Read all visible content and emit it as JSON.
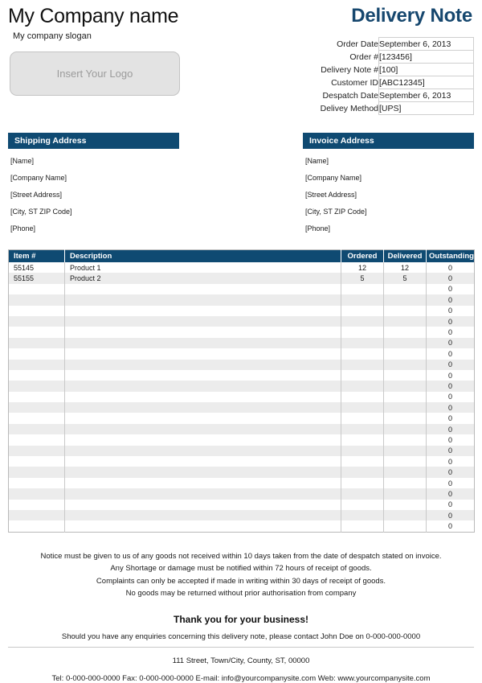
{
  "company": {
    "name": "My Company name",
    "slogan": "My company slogan",
    "logo_placeholder": "Insert Your Logo"
  },
  "document": {
    "title": "Delivery Note",
    "accent_color": "#0f4a72",
    "title_color": "#16476e",
    "fields": [
      {
        "label": "Order Date",
        "value": "September 6, 2013"
      },
      {
        "label": "Order #",
        "value": "[123456]"
      },
      {
        "label": "Delivery Note #",
        "value": "[100]"
      },
      {
        "label": "Customer ID",
        "value": "[ABC12345]"
      },
      {
        "label": "Despatch Date",
        "value": "September 6, 2013"
      },
      {
        "label": "Delivey Method",
        "value": "[UPS]"
      }
    ]
  },
  "shipping_address": {
    "heading": "Shipping Address",
    "lines": [
      "[Name]",
      "[Company Name]",
      "[Street Address]",
      "[City, ST  ZIP Code]",
      "[Phone]"
    ]
  },
  "invoice_address": {
    "heading": "Invoice Address",
    "lines": [
      "[Name]",
      "[Company Name]",
      "[Street Address]",
      "[City, ST  ZIP Code]",
      "[Phone]"
    ]
  },
  "items_table": {
    "columns": [
      "Item #",
      "Description",
      "Ordered",
      "Delivered",
      "Outstanding"
    ],
    "rows": [
      {
        "item": "55145",
        "description": "Product 1",
        "ordered": "12",
        "delivered": "12",
        "outstanding": "0"
      },
      {
        "item": "55155",
        "description": "Product 2",
        "ordered": "5",
        "delivered": "5",
        "outstanding": "0"
      },
      {
        "item": "",
        "description": "",
        "ordered": "",
        "delivered": "",
        "outstanding": "0"
      },
      {
        "item": "",
        "description": "",
        "ordered": "",
        "delivered": "",
        "outstanding": "0"
      },
      {
        "item": "",
        "description": "",
        "ordered": "",
        "delivered": "",
        "outstanding": "0"
      },
      {
        "item": "",
        "description": "",
        "ordered": "",
        "delivered": "",
        "outstanding": "0"
      },
      {
        "item": "",
        "description": "",
        "ordered": "",
        "delivered": "",
        "outstanding": "0"
      },
      {
        "item": "",
        "description": "",
        "ordered": "",
        "delivered": "",
        "outstanding": "0"
      },
      {
        "item": "",
        "description": "",
        "ordered": "",
        "delivered": "",
        "outstanding": "0"
      },
      {
        "item": "",
        "description": "",
        "ordered": "",
        "delivered": "",
        "outstanding": "0"
      },
      {
        "item": "",
        "description": "",
        "ordered": "",
        "delivered": "",
        "outstanding": "0"
      },
      {
        "item": "",
        "description": "",
        "ordered": "",
        "delivered": "",
        "outstanding": "0"
      },
      {
        "item": "",
        "description": "",
        "ordered": "",
        "delivered": "",
        "outstanding": "0"
      },
      {
        "item": "",
        "description": "",
        "ordered": "",
        "delivered": "",
        "outstanding": "0"
      },
      {
        "item": "",
        "description": "",
        "ordered": "",
        "delivered": "",
        "outstanding": "0"
      },
      {
        "item": "",
        "description": "",
        "ordered": "",
        "delivered": "",
        "outstanding": "0"
      },
      {
        "item": "",
        "description": "",
        "ordered": "",
        "delivered": "",
        "outstanding": "0"
      },
      {
        "item": "",
        "description": "",
        "ordered": "",
        "delivered": "",
        "outstanding": "0"
      },
      {
        "item": "",
        "description": "",
        "ordered": "",
        "delivered": "",
        "outstanding": "0"
      },
      {
        "item": "",
        "description": "",
        "ordered": "",
        "delivered": "",
        "outstanding": "0"
      },
      {
        "item": "",
        "description": "",
        "ordered": "",
        "delivered": "",
        "outstanding": "0"
      },
      {
        "item": "",
        "description": "",
        "ordered": "",
        "delivered": "",
        "outstanding": "0"
      },
      {
        "item": "",
        "description": "",
        "ordered": "",
        "delivered": "",
        "outstanding": "0"
      },
      {
        "item": "",
        "description": "",
        "ordered": "",
        "delivered": "",
        "outstanding": "0"
      },
      {
        "item": "",
        "description": "",
        "ordered": "",
        "delivered": "",
        "outstanding": "0"
      }
    ]
  },
  "notices": [
    "Notice must be given to us of any goods not received within 10 days taken from the date of despatch stated on invoice.",
    "Any Shortage or damage must be notified within 72 hours of receipt of goods.",
    "Complaints can only be accepted if made in writing within 30 days of receipt of goods.",
    "No goods may be returned without prior authorisation from company"
  ],
  "footer": {
    "thanks": "Thank you for your business!",
    "enquiries": "Should you have any enquiries concerning this delivery note, please contact John Doe on 0-000-000-0000",
    "address": "111 Street, Town/City, County, ST, 00000",
    "contact": "Tel: 0-000-000-0000 Fax: 0-000-000-0000 E-mail: info@yourcompanysite.com Web: www.yourcompanysite.com"
  }
}
